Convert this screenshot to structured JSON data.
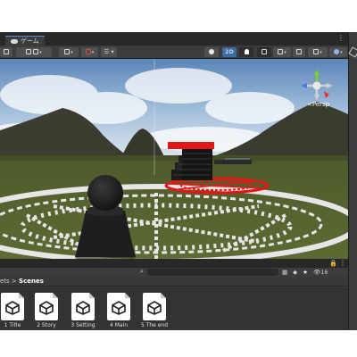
{
  "window": {
    "tab_label": "ゲーム",
    "more_menu": "⋮"
  },
  "toolbar": {
    "layers_label": "☰ ▾",
    "mode_2d": "2D",
    "gizmo_count": "▾"
  },
  "scene": {
    "camera_mode": "<Persp"
  },
  "project": {
    "lock_icon": "🔒",
    "more_menu": "⋮",
    "visible_count": "16",
    "breadcrumb_parent": "ets",
    "breadcrumb_sep": " > ",
    "breadcrumb_current": "Scenes",
    "assets": [
      {
        "name": "1 Title"
      },
      {
        "name": "2 Story"
      },
      {
        "name": "3 Setting"
      },
      {
        "name": "4 Main"
      },
      {
        "name": "5 The end"
      }
    ]
  },
  "colors": {
    "sky_top": "#5b86b8",
    "grass": "#56622f",
    "circle": "#e6e6e6",
    "red_marker": "#e21818",
    "accent": "#3a6da8"
  }
}
